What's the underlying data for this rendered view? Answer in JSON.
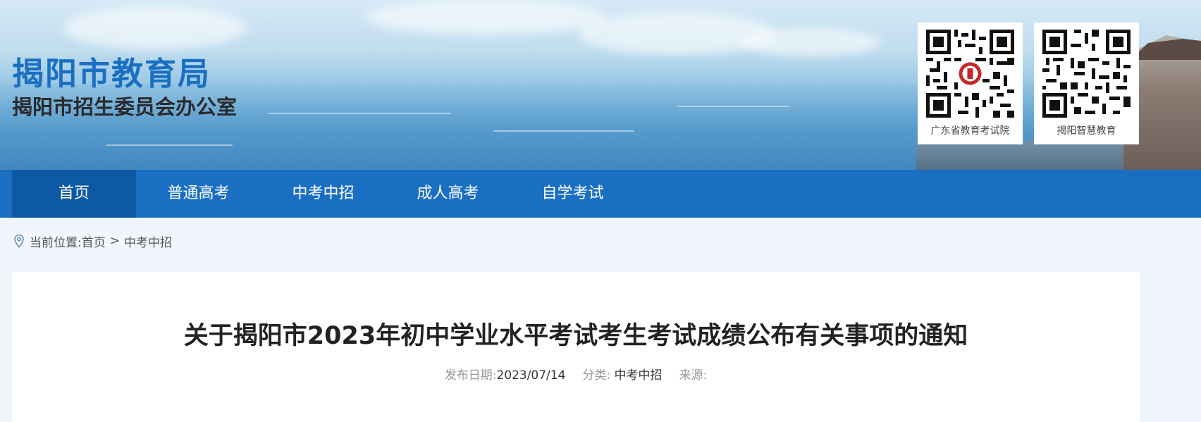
{
  "header": {
    "title": "揭阳市教育局",
    "subtitle": "揭阳市招生委员会办公室",
    "qr_codes": [
      {
        "label": "广东省教育考试院",
        "icon": "qr-code-icon"
      },
      {
        "label": "揭阳智慧教育",
        "icon": "qr-code-icon"
      }
    ]
  },
  "nav": {
    "items": [
      {
        "label": "首页",
        "active": true
      },
      {
        "label": "普通高考",
        "active": false
      },
      {
        "label": "中考中招",
        "active": false
      },
      {
        "label": "成人高考",
        "active": false
      },
      {
        "label": "自学考试",
        "active": false
      }
    ]
  },
  "breadcrumb": {
    "icon": "location-pin-icon",
    "prefix": "当前位置:",
    "home": "首页",
    "separator": ">",
    "current": "中考中招"
  },
  "article": {
    "title": "关于揭阳市2023年初中学业水平考试考生考试成绩公布有关事项的通知",
    "date_label": "发布日期:",
    "date": "2023/07/14",
    "category_label": "分类:",
    "category": "中考中招",
    "source_label": "来源:",
    "source": ""
  },
  "colors": {
    "primary": "#1a6fc2",
    "nav_active": "#0e59a6",
    "page_bg": "#f0f6fc"
  }
}
